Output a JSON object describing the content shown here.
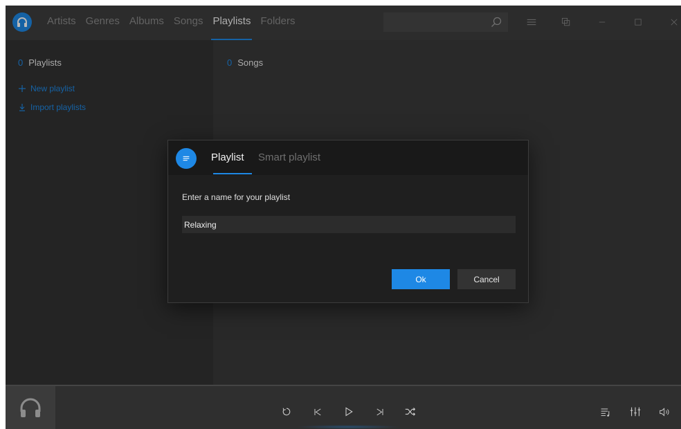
{
  "nav": {
    "tabs": [
      {
        "label": "Artists"
      },
      {
        "label": "Genres"
      },
      {
        "label": "Albums"
      },
      {
        "label": "Songs"
      },
      {
        "label": "Playlists"
      },
      {
        "label": "Folders"
      }
    ],
    "active_tab": "Playlists"
  },
  "search": {
    "value": "",
    "placeholder": ""
  },
  "left_panel": {
    "count": "0",
    "title": "Playlists",
    "actions": {
      "new_playlist": "New playlist",
      "import_playlists": "Import playlists"
    }
  },
  "right_panel": {
    "count": "0",
    "title": "Songs"
  },
  "dialog": {
    "tabs": {
      "playlist": "Playlist",
      "smart_playlist": "Smart playlist"
    },
    "active_tab": "Playlist",
    "prompt": "Enter a name for your playlist",
    "input_value": "Relaxing",
    "ok_label": "Ok",
    "cancel_label": "Cancel"
  },
  "colors": {
    "accent": "#1e88e5",
    "background": "#3a3a3a",
    "dialog_bg": "#1f1f1f"
  },
  "icons": {
    "app_logo": "headphones-icon",
    "search": "search-icon",
    "menu": "hamburger-menu-icon",
    "mini_player": "mini-player-icon",
    "minimize": "minimize-icon",
    "maximize": "maximize-icon",
    "close": "close-icon",
    "dialog": "playlist-list-icon",
    "repeat": "repeat-icon",
    "previous": "previous-track-icon",
    "play": "play-icon",
    "next": "next-track-icon",
    "shuffle": "shuffle-icon",
    "queue": "now-playing-queue-icon",
    "equalizer": "equalizer-icon",
    "volume": "volume-icon"
  }
}
